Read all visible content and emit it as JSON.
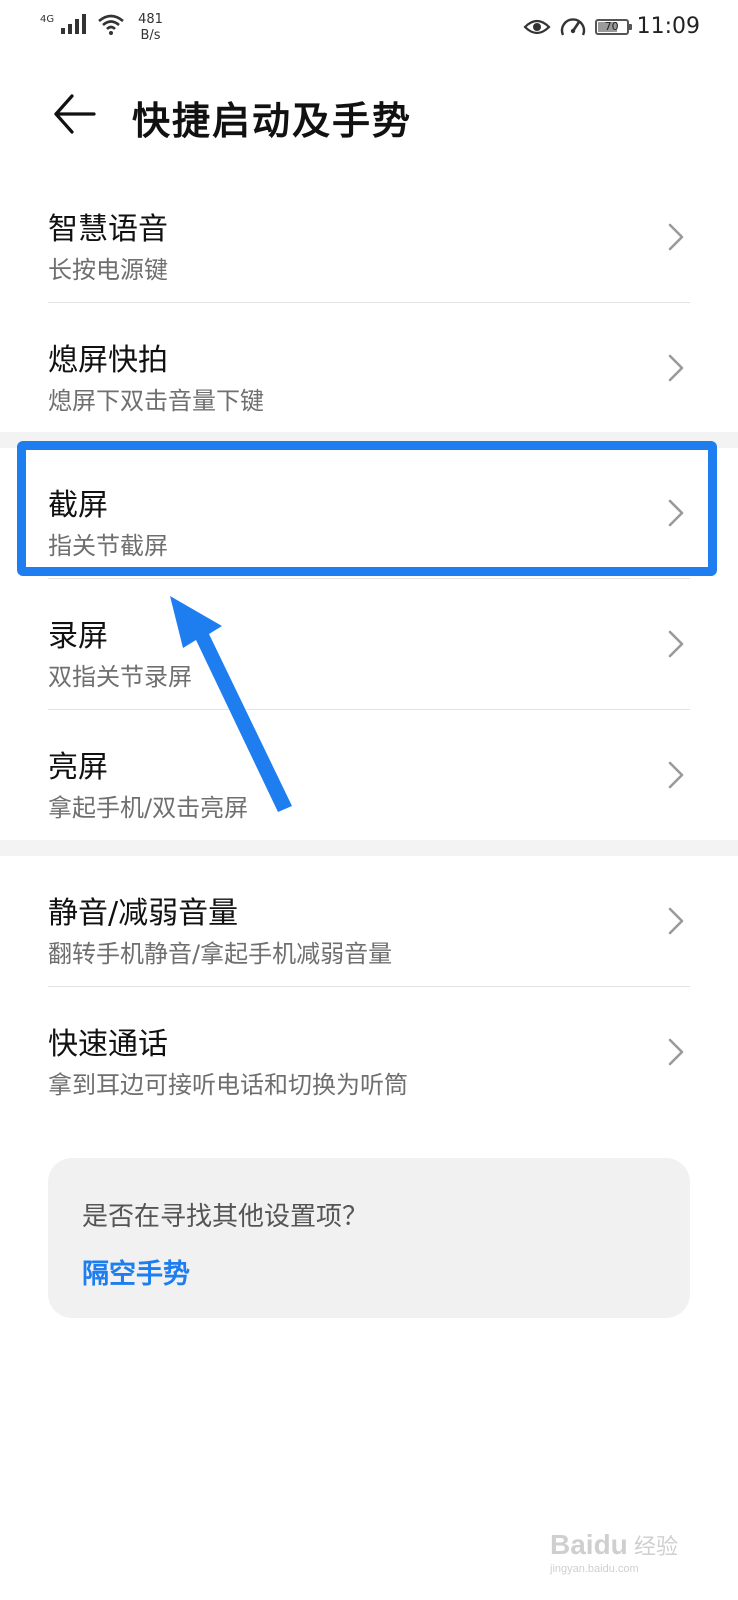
{
  "status_bar": {
    "network": "4G",
    "speed_value": "481",
    "speed_unit": "B/s",
    "battery": "70",
    "time": "11:09"
  },
  "app_bar": {
    "title": "快捷启动及手势"
  },
  "items": [
    {
      "title": "智慧语音",
      "subtitle": "长按电源键"
    },
    {
      "title": "熄屏快拍",
      "subtitle": "熄屏下双击音量下键"
    },
    {
      "title": "截屏",
      "subtitle": "指关节截屏"
    },
    {
      "title": "录屏",
      "subtitle": "双指关节录屏"
    },
    {
      "title": "亮屏",
      "subtitle": "拿起手机/双击亮屏"
    },
    {
      "title": "静音/减弱音量",
      "subtitle": "翻转手机静音/拿起手机减弱音量"
    },
    {
      "title": "快速通话",
      "subtitle": "拿到耳边可接听电话和切换为听筒"
    }
  ],
  "hint": {
    "question": "是否在寻找其他设置项？",
    "link": "隔空手势"
  },
  "colors": {
    "accent": "#1e7ef0",
    "highlight": "#1e7ef0"
  },
  "watermark": {
    "brand": "Baidu",
    "brand_cn": "经验",
    "site": "jingyan.baidu.com"
  }
}
